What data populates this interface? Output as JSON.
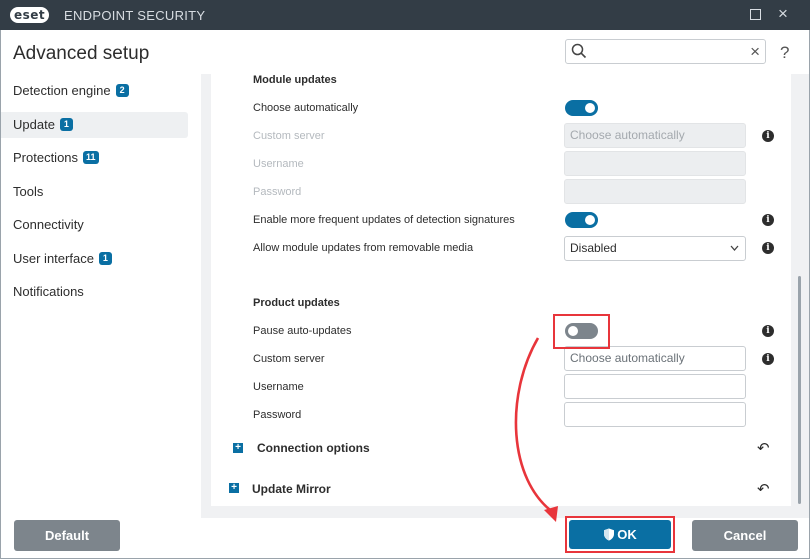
{
  "window": {
    "logo_text": "eset",
    "product_name": "ENDPOINT SECURITY",
    "maximize_icon": "square-icon",
    "close_icon": "×"
  },
  "header": {
    "title": "Advanced setup",
    "search_value": "",
    "help": "?"
  },
  "sidebar": {
    "items": [
      {
        "label": "Detection engine",
        "badge": "2"
      },
      {
        "label": "Update",
        "badge": "1",
        "active": true
      },
      {
        "label": "Protections",
        "badge": "11"
      },
      {
        "label": "Tools",
        "badge": ""
      },
      {
        "label": "Connectivity",
        "badge": ""
      },
      {
        "label": "User interface",
        "badge": "1"
      },
      {
        "label": "Notifications",
        "badge": ""
      }
    ]
  },
  "module_updates": {
    "title": "Module updates",
    "choose_automatically": {
      "label": "Choose automatically",
      "on": true
    },
    "custom_server": {
      "label": "Custom server",
      "value": "Choose automatically"
    },
    "username": {
      "label": "Username",
      "value": ""
    },
    "password": {
      "label": "Password",
      "value": ""
    },
    "frequent_updates": {
      "label": "Enable more frequent updates of detection signatures",
      "on": true
    },
    "removable_media": {
      "label": "Allow module updates from removable media",
      "value": "Disabled"
    }
  },
  "product_updates": {
    "title": "Product updates",
    "pause_auto_updates": {
      "label": "Pause auto-updates",
      "on": false
    },
    "custom_server": {
      "label": "Custom server",
      "value": "Choose automatically"
    },
    "username": {
      "label": "Username",
      "value": ""
    },
    "password": {
      "label": "Password",
      "value": ""
    }
  },
  "expanders": {
    "connection_options": "Connection options",
    "update_mirror": "Update Mirror",
    "plus": "+",
    "revert": "↶"
  },
  "info_glyph": "i",
  "buttons": {
    "default": "Default",
    "ok": "OK",
    "cancel": "Cancel"
  },
  "colors": {
    "accent": "#0a6fa3",
    "titlebar": "#333d46",
    "highlight": "#e8353b",
    "button_gray": "#7d858c"
  }
}
